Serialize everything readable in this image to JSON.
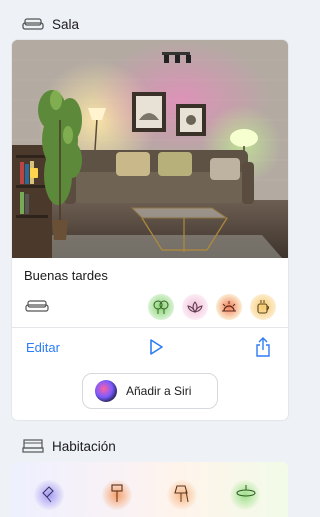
{
  "sections": {
    "sala": {
      "title": "Sala"
    },
    "habitacion": {
      "title": "Habitación"
    }
  },
  "scene": {
    "title": "Buenas tardes",
    "bulbs": [
      {
        "icon": "tree-icon",
        "color": "#7fd36a"
      },
      {
        "icon": "lotus-icon",
        "color": "#f1b7d6"
      },
      {
        "icon": "sunrise-icon",
        "color": "#f08a6a"
      },
      {
        "icon": "cup-icon",
        "color": "#f6c460"
      }
    ]
  },
  "actions": {
    "edit_label": "Editar",
    "siri_label": "Añadir a Siri"
  },
  "colors": {
    "accent": "#2e7cf6",
    "background": "#eef1f5"
  }
}
